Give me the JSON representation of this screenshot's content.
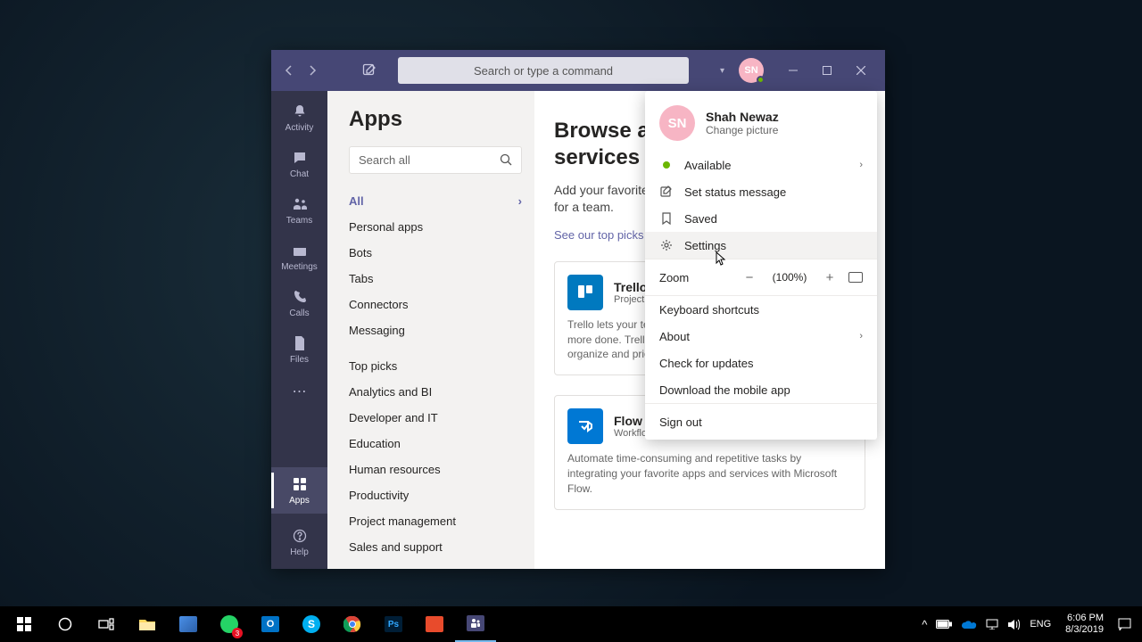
{
  "titlebar": {
    "search_placeholder": "Search or type a command",
    "avatar_initials": "SN"
  },
  "rail": {
    "items": [
      {
        "label": "Activity"
      },
      {
        "label": "Chat"
      },
      {
        "label": "Teams"
      },
      {
        "label": "Meetings"
      },
      {
        "label": "Calls"
      },
      {
        "label": "Files"
      }
    ],
    "apps_label": "Apps",
    "help_label": "Help"
  },
  "left_panel": {
    "title": "Apps",
    "search_placeholder": "Search all",
    "categories_top": [
      "All",
      "Personal apps",
      "Bots",
      "Tabs",
      "Connectors",
      "Messaging"
    ],
    "categories_bottom": [
      "Top picks",
      "Analytics and BI",
      "Developer and IT",
      "Education",
      "Human resources",
      "Productivity",
      "Project management",
      "Sales and support"
    ]
  },
  "main": {
    "heading_l1": "Browse available apps and",
    "heading_l2": "services",
    "sub_l1": "Add your favorite apps for personal use or",
    "sub_l2": "for a team.",
    "link": "See our top picks",
    "cards": [
      {
        "title": "Trello",
        "sub": "Project management",
        "desc": "Trello lets your team work more collaboratively and get more done. Trello boards, lists, and cards enable you to organize and prioritize your projects.",
        "color": "#0079bf"
      },
      {
        "title": "Flow",
        "sub": "Workflow automation",
        "desc": "Automate time-consuming and repetitive tasks by integrating your favorite apps and services with Microsoft Flow.",
        "color": "#0078d4"
      }
    ]
  },
  "dropdown": {
    "user_name": "Shah Newaz",
    "change_picture": "Change picture",
    "avatar_initials": "SN",
    "status": "Available",
    "set_status": "Set status message",
    "saved": "Saved",
    "settings": "Settings",
    "zoom_label": "Zoom",
    "zoom_value": "(100%)",
    "keyboard": "Keyboard shortcuts",
    "about": "About",
    "updates": "Check for updates",
    "download": "Download the mobile app",
    "signout": "Sign out"
  },
  "taskbar": {
    "lang": "ENG",
    "time": "6:06 PM",
    "date": "8/3/2019"
  }
}
